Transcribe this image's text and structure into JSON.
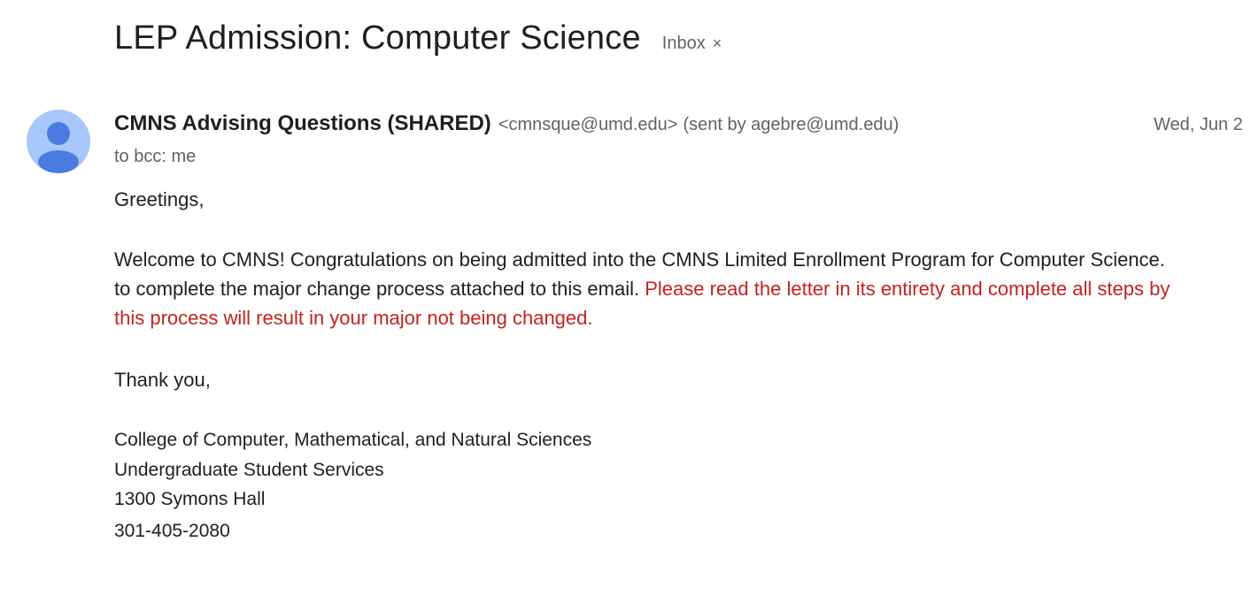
{
  "email": {
    "subject": "LEP Admission: Computer Science",
    "label": "Inbox",
    "label_remove": "×",
    "sender_name": "CMNS Advising Questions (SHARED)",
    "sender_email": "<cmnsque@umd.edu>",
    "sent_by": "(sent by agebre@umd.edu)",
    "date": "Wed, Jun 2",
    "recipients": "to bcc: me",
    "body": {
      "greeting": "Greetings,",
      "line1": "Welcome to CMNS! Congratulations on being admitted into the CMNS Limited Enrollment Program for Computer Science.",
      "line2_plain": "to complete the major change process attached to this email.",
      "line2_red": "Please read the letter in its entirety and complete all steps by",
      "line3_red": "this process will result in your major not being changed.",
      "closing": "Thank you,"
    },
    "signature": {
      "org": "College of Computer, Mathematical, and Natural Sciences",
      "dept": "Undergraduate Student Services",
      "address": "1300 Symons Hall",
      "phone": "301-405-2080"
    }
  },
  "colors": {
    "avatar_bg": "#a8c7fa",
    "avatar_fg": "#4a7be0",
    "warning_red": "#c5221f",
    "muted_gray": "#5f6368"
  },
  "icons": {
    "avatar": "default-person-avatar-icon",
    "label_remove": "close-icon"
  }
}
